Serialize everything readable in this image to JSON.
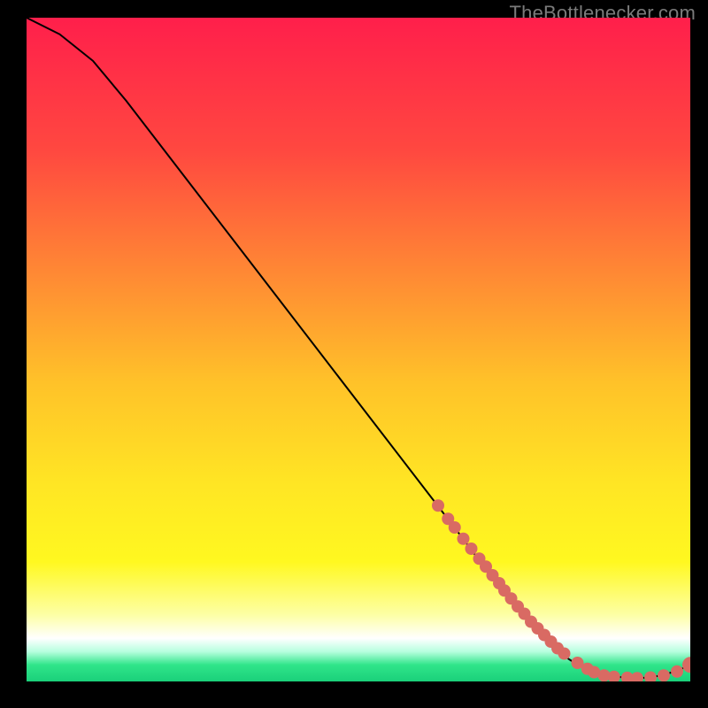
{
  "watermark": "TheBottlenecker.com",
  "chart_data": {
    "type": "line",
    "title": "",
    "xlabel": "",
    "ylabel": "",
    "xlim": [
      0,
      100
    ],
    "ylim": [
      0,
      100
    ],
    "background_gradient": {
      "stops": [
        {
          "offset": 0.0,
          "color": "#ff1f4b"
        },
        {
          "offset": 0.2,
          "color": "#ff4840"
        },
        {
          "offset": 0.4,
          "color": "#ff8e33"
        },
        {
          "offset": 0.55,
          "color": "#ffc229"
        },
        {
          "offset": 0.7,
          "color": "#ffe524"
        },
        {
          "offset": 0.82,
          "color": "#fff820"
        },
        {
          "offset": 0.9,
          "color": "#fdffa6"
        },
        {
          "offset": 0.935,
          "color": "#ffffff"
        },
        {
          "offset": 0.955,
          "color": "#b7ffdf"
        },
        {
          "offset": 0.975,
          "color": "#30e58a"
        },
        {
          "offset": 1.0,
          "color": "#1ad07a"
        }
      ]
    },
    "series": [
      {
        "name": "bottleneck-curve",
        "x": [
          0,
          5,
          10,
          15,
          20,
          25,
          30,
          35,
          40,
          45,
          50,
          55,
          60,
          65,
          68,
          72,
          75,
          78,
          80,
          83,
          86,
          88,
          90,
          92,
          94,
          96,
          98,
          100
        ],
        "y": [
          100,
          97.5,
          93.5,
          87.5,
          81,
          74.5,
          68,
          61.5,
          55,
          48.5,
          42,
          35.5,
          29,
          22.5,
          18.5,
          13.5,
          10,
          6.5,
          4.5,
          2.5,
          1.2,
          0.8,
          0.6,
          0.5,
          0.6,
          1.0,
          1.6,
          2.5
        ]
      }
    ],
    "markers": {
      "name": "highlight-points",
      "color": "#d96a63",
      "x": [
        62,
        63.5,
        64.5,
        65.8,
        67,
        68.2,
        69.2,
        70.2,
        71.2,
        72,
        73,
        74,
        75,
        76,
        77,
        78,
        79,
        80,
        81,
        83,
        84.5,
        85.5,
        87,
        88.5,
        90.5,
        92,
        94,
        96,
        98,
        100
      ],
      "y": [
        26.5,
        24.5,
        23.2,
        21.5,
        20,
        18.5,
        17.3,
        16,
        14.8,
        13.7,
        12.5,
        11.3,
        10.2,
        9.0,
        8.0,
        7.0,
        6.0,
        5.0,
        4.2,
        2.8,
        1.9,
        1.4,
        0.9,
        0.7,
        0.55,
        0.5,
        0.6,
        0.9,
        1.5,
        2.5
      ],
      "r": [
        7,
        7,
        7,
        7,
        7,
        7,
        7,
        7,
        7,
        7,
        7,
        7,
        7,
        7,
        7,
        7,
        7,
        7,
        7,
        7,
        7,
        7,
        7,
        7,
        7,
        7,
        7,
        7,
        7,
        9
      ]
    }
  }
}
